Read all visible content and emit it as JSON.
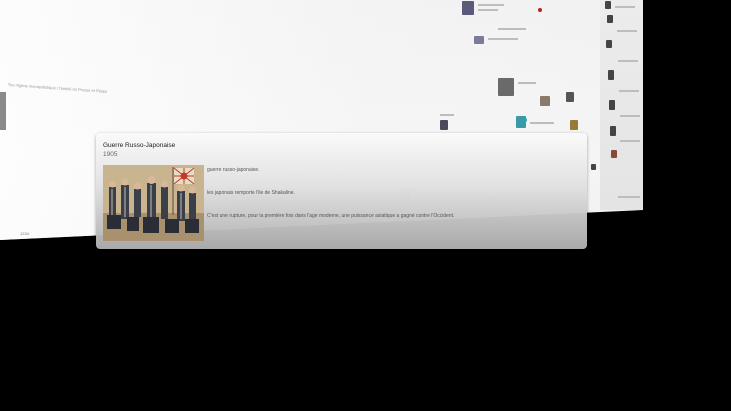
{
  "background_page": {
    "caption": "Tue régime monopolistique / l'amitié du Prusse et Pétain",
    "bottom_tag": "1234"
  },
  "event": {
    "title": "Guerre Russo-Japonaise",
    "date": "1905",
    "image_alt": "illustration de soldats japonais avec drapeau",
    "paragraphs": [
      "guerre russo-japonaise.",
      "les japonais remporte l'ile de Shakaline.",
      "C'est une rupture, pour la première fois dans l'age moderne, une puissance asiatique a gagné contre l'Occident."
    ]
  },
  "colors": {
    "card_top": "#fafafa",
    "card_bottom": "#afafaf",
    "background": "#000000",
    "flag_red": "#c0392b"
  }
}
